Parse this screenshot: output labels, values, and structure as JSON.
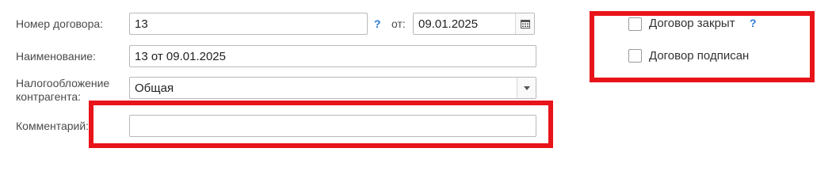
{
  "form": {
    "contract_number_label": "Номер договора:",
    "contract_number_value": "13",
    "help_mark": "?",
    "date_label": "от:",
    "date_value": "09.01.2025",
    "name_label": "Наименование:",
    "name_value": "13 от 09.01.2025",
    "taxation_label_line1": "Налогообложение",
    "taxation_label_line2": "контрагента:",
    "taxation_value": "Общая",
    "comment_label": "Комментарий:",
    "comment_value": ""
  },
  "checkboxes": {
    "closed_label": "Договор закрыт",
    "closed_checked": false,
    "signed_label": "Договор подписан",
    "signed_checked": false
  },
  "colors": {
    "highlight": "#e8141a",
    "help": "#2a7bd4"
  },
  "icons": [
    "calendar-icon",
    "chevron-down-icon",
    "help-icon"
  ]
}
